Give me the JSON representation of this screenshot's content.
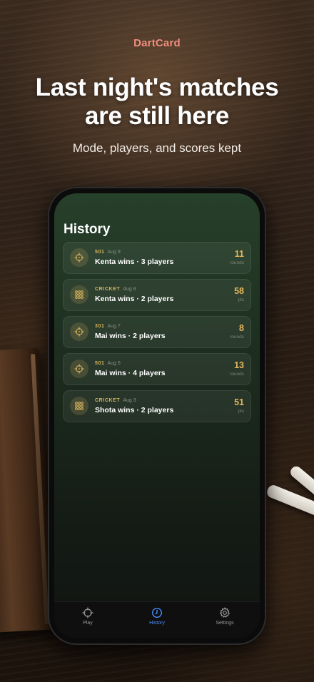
{
  "brand": "DartCard",
  "headline_line1": "Last night's matches",
  "headline_line2": "are still here",
  "subline": "Mode, players, and scores kept",
  "screen": {
    "title": "History",
    "matches": [
      {
        "mode": "501",
        "date": "Aug 9",
        "summary": "Kenta wins · 3 players",
        "score": "11",
        "unit": "rounds",
        "icon": "crosshair-icon"
      },
      {
        "mode": "CRICKET",
        "date": "Aug 8",
        "summary": "Kenta wins · 2 players",
        "score": "58",
        "unit": "pts",
        "icon": "grid-dots-icon"
      },
      {
        "mode": "301",
        "date": "Aug 7",
        "summary": "Mai wins · 2 players",
        "score": "8",
        "unit": "rounds",
        "icon": "crosshair-icon"
      },
      {
        "mode": "501",
        "date": "Aug 5",
        "summary": "Mai wins · 4 players",
        "score": "13",
        "unit": "rounds",
        "icon": "crosshair-icon"
      },
      {
        "mode": "CRICKET",
        "date": "Aug 3",
        "summary": "Shota wins · 2 players",
        "score": "51",
        "unit": "pts",
        "icon": "grid-dots-icon"
      }
    ],
    "tabs": [
      {
        "label": "Play",
        "icon": "crosshair-icon"
      },
      {
        "label": "History",
        "icon": "clock-icon"
      },
      {
        "label": "Settings",
        "icon": "gear-icon"
      }
    ]
  },
  "colors": {
    "brand": "#f08c7c",
    "accent_gold": "#e4b75a",
    "active_tab": "#4a8dff"
  }
}
